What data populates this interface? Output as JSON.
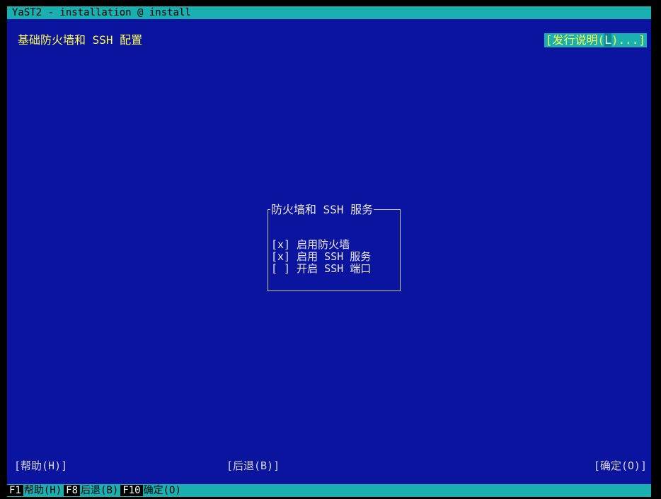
{
  "window": {
    "title": "YaST2 - installation @ install"
  },
  "header": {
    "title": "基础防火墙和 SSH 配置",
    "release_notes": {
      "prefix": "[发行说明(",
      "hotkey": "L",
      "suffix": ")...]"
    }
  },
  "firewall_frame": {
    "title": "防火墙和 SSH 服务",
    "options": [
      {
        "checkbox": "[x]",
        "label": "启用防火墙"
      },
      {
        "checkbox": "[x]",
        "label": "启用 SSH 服务"
      },
      {
        "checkbox": "[ ]",
        "label": "开启 SSH 端口"
      }
    ]
  },
  "buttons": {
    "help": "[帮助(H)]",
    "back": "[后退(B)]",
    "ok": "[确定(O)]"
  },
  "function_keys": [
    {
      "key": "F1",
      "label": "帮助(H)"
    },
    {
      "key": "F8",
      "label": "后退(B)"
    },
    {
      "key": "F10",
      "label": "确定(O)"
    }
  ],
  "colors": {
    "background": "#0b149e",
    "bar": "#1ab0b0",
    "title_text": "#ffff54"
  }
}
